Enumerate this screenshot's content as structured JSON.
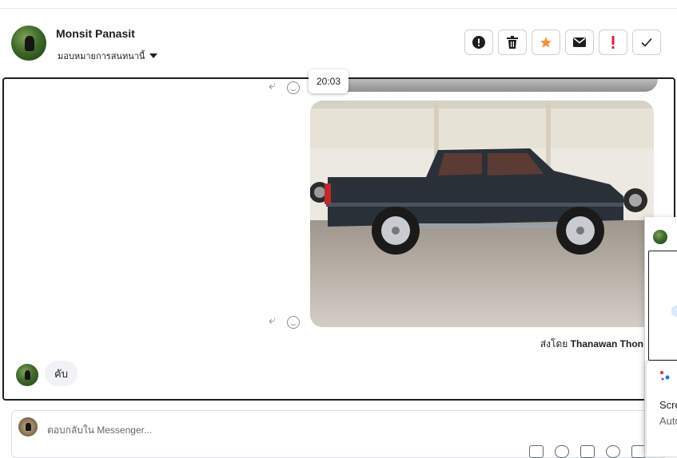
{
  "header": {
    "contact_name": "Monsit Panasit",
    "assign_label": "มอบหมายการสนทนานี้",
    "actions": [
      {
        "name": "report-button",
        "icon": "alert-circle-icon"
      },
      {
        "name": "delete-button",
        "icon": "trash-icon"
      },
      {
        "name": "star-button",
        "icon": "star-icon"
      },
      {
        "name": "mark-unread-button",
        "icon": "envelope-icon"
      },
      {
        "name": "important-button",
        "icon": "exclamation-icon"
      },
      {
        "name": "done-button",
        "icon": "check-icon"
      }
    ]
  },
  "thread": {
    "tooltip_time": "20:03",
    "sent_by_prefix": "ส่งโดย",
    "sent_by_name": "Thanawan Thon",
    "incoming_message": "คับ"
  },
  "composer": {
    "placeholder": "ตอบกลับใน Messenger..."
  },
  "side_popup": {
    "text_line1": "Scre",
    "text_line2": "Auto"
  },
  "colors": {
    "star": "#f7923b",
    "important": "#e41e3f"
  }
}
